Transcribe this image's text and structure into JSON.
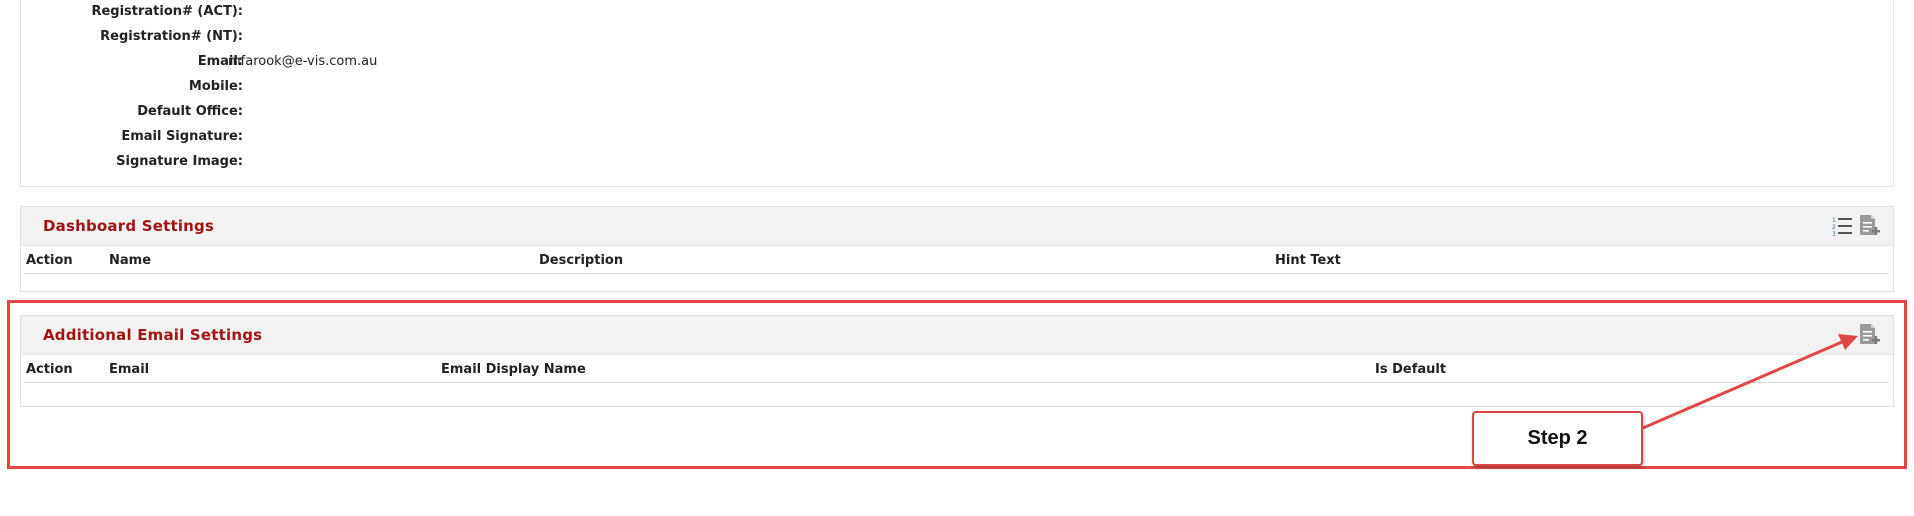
{
  "profile": {
    "fields": [
      {
        "label": "Registration# (ACT):",
        "value": ""
      },
      {
        "label": "Registration# (NT):",
        "value": ""
      },
      {
        "label": "Email:",
        "value": "mfarook@e-vis.com.au"
      },
      {
        "label": "Mobile:",
        "value": ""
      },
      {
        "label": "Default Office:",
        "value": ""
      },
      {
        "label": "Email Signature:",
        "value": ""
      },
      {
        "label": "Signature Image:",
        "value": ""
      }
    ]
  },
  "dashboard_settings": {
    "title": "Dashboard Settings",
    "icons": [
      "ordered-list-icon",
      "add-document-icon"
    ],
    "columns": [
      "Action",
      "Name",
      "Description",
      "Hint Text"
    ]
  },
  "additional_email_settings": {
    "title": "Additional Email Settings",
    "icons": [
      "add-document-icon"
    ],
    "columns": [
      "Action",
      "Email",
      "Email Display Name",
      "Is Default"
    ]
  },
  "annotation": {
    "callout_text": "Step 2",
    "color": "#e04848"
  },
  "colors": {
    "section_title": "#a31515",
    "header_bg": "#f2f2f2"
  }
}
